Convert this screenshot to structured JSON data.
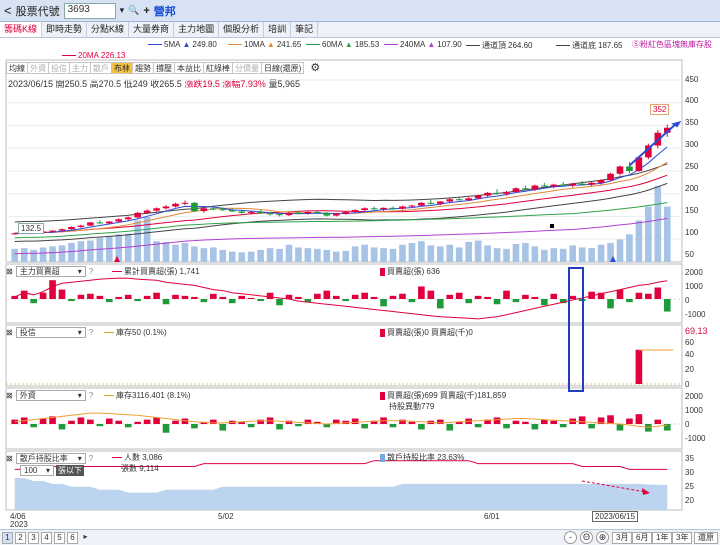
{
  "topbar": {
    "back_glyph": "<",
    "label": "股票代號",
    "code": "3693",
    "dropdown_glyph": "▾",
    "search_glyph": "🔍",
    "plus_glyph": "+",
    "name": "營邦"
  },
  "tabs": [
    {
      "label": "籌碼K線",
      "active": true
    },
    {
      "label": "即時走勢",
      "active": false
    },
    {
      "label": "分點K線",
      "active": false
    },
    {
      "label": "大量券商",
      "active": false
    },
    {
      "label": "主力地圖",
      "active": false
    },
    {
      "label": "個股分析",
      "active": false
    },
    {
      "label": "培訓",
      "active": false
    },
    {
      "label": "筆記",
      "active": false
    }
  ],
  "ma": [
    {
      "label": "20MA",
      "value": "226.13",
      "color": "#e1003c"
    },
    {
      "label": "5MA",
      "value": "249.80",
      "color": "#2a4bd7"
    },
    {
      "label": "10MA",
      "value": "241.65",
      "color": "#e08a3a"
    },
    {
      "label": "60MA",
      "value": "185.53",
      "color": "#2fa44a"
    },
    {
      "label": "240MA",
      "value": "107.90",
      "color": "#b13fd1"
    },
    {
      "label": "通道頂",
      "value": "264.60",
      "color": "#444444"
    },
    {
      "label": "通道底",
      "value": "187.65",
      "color": "#444444"
    }
  ],
  "ma_arrow": "▲",
  "hint": "Ⓢ粉紅色區塊無庫存股",
  "ind_tabs": [
    {
      "label": "均線",
      "dim": false,
      "active": false
    },
    {
      "label": "外資",
      "dim": true,
      "active": false
    },
    {
      "label": "投信",
      "dim": true,
      "active": false
    },
    {
      "label": "主力",
      "dim": true,
      "active": false
    },
    {
      "label": "散戶",
      "dim": true,
      "active": false
    },
    {
      "label": "布林",
      "dim": false,
      "active": true
    },
    {
      "label": "趨勢",
      "dim": false,
      "active": false
    },
    {
      "label": "撐壓",
      "dim": false,
      "active": false
    },
    {
      "label": "本益比",
      "dim": false,
      "active": false
    },
    {
      "label": "紅綠棒",
      "dim": false,
      "active": false
    },
    {
      "label": "分價量",
      "dim": true,
      "active": false
    },
    {
      "label": "日線(還原)",
      "dim": false,
      "active": false
    }
  ],
  "settings_glyph": "⚙",
  "quote": {
    "date": "2023/06/15",
    "open_label": "開",
    "open": "250.5",
    "high_label": "高",
    "high": "270.5",
    "low_label": "低",
    "low": "249",
    "close_label": "收",
    "close": "265.5",
    "chg_label": "漲跌",
    "chg": "19.5",
    "pct_label": "漲幅",
    "pct": "7.93%",
    "vol_label": "量",
    "vol": "5,965"
  },
  "price_y_labels": [
    "450",
    "400",
    "350",
    "300",
    "250",
    "200",
    "150",
    "100",
    "50"
  ],
  "price_badge_high": "352",
  "price_badge_low": "132.5",
  "pane1": {
    "select": "主力買賣超",
    "help": "?",
    "legend1": "累計買賣超(張) 1,741",
    "legend2": "買賣超(張) 636",
    "y_labels": [
      "2000",
      "1000",
      "0",
      "-1000",
      "-2000"
    ]
  },
  "pane2": {
    "select": "投信",
    "help": "?",
    "legend1": "庫存50 (0.1%)",
    "legend2": "買賣超(張)0 買賣超(千)0",
    "right_value": "69.13",
    "y_labels": [
      "60",
      "40",
      "20",
      "0"
    ]
  },
  "pane3": {
    "select": "外資",
    "help": "?",
    "legend1": "庫存3116.401 (8.1%)",
    "legend2": "買賣超(張)699 買賣超(千)181,859",
    "legend3": "持股異動779",
    "y_labels": [
      "2000",
      "1000",
      "0",
      "-1000",
      "-2000"
    ]
  },
  "pane4": {
    "select": "散戶持股比率",
    "help": "?",
    "sub_select": "100",
    "sub_label": "張以下",
    "legend1": "人數 3,086",
    "legend1b": "張數 9,114",
    "legend2": "散戶持股比率 23.63%",
    "y_labels": [
      "35",
      "30",
      "25",
      "20"
    ]
  },
  "x_labels": [
    {
      "text": "4/06",
      "sub": "2023"
    },
    {
      "text": "5/02",
      "sub": ""
    },
    {
      "text": "6/01",
      "sub": ""
    }
  ],
  "x_cursor_date": "2023/06/15",
  "pages": [
    "1",
    "2",
    "3",
    "4",
    "5",
    "6"
  ],
  "page_next": "▸",
  "zoom": [
    "-",
    "Θ",
    "⊕"
  ],
  "periods": [
    "3月",
    "6月",
    "1年",
    "3年",
    "還原"
  ],
  "colors": {
    "up": "#e1003c",
    "down": "#1f9a3a",
    "vol": "#a7c3e6"
  },
  "chart_data": {
    "type": "candlestick",
    "candles": [
      [
        112,
        114,
        110,
        113
      ],
      [
        113,
        116,
        112,
        115
      ],
      [
        115,
        118,
        113,
        114
      ],
      [
        114,
        118,
        113,
        117
      ],
      [
        117,
        120,
        115,
        119
      ],
      [
        119,
        124,
        118,
        122
      ],
      [
        122,
        128,
        121,
        127
      ],
      [
        127,
        132,
        125,
        130
      ],
      [
        130,
        138,
        129,
        137
      ],
      [
        137,
        142,
        134,
        135
      ],
      [
        135,
        140,
        133,
        139
      ],
      [
        139,
        146,
        137,
        144
      ],
      [
        144,
        150,
        142,
        148
      ],
      [
        148,
        160,
        146,
        158
      ],
      [
        158,
        166,
        155,
        163
      ],
      [
        163,
        170,
        160,
        168
      ],
      [
        168,
        175,
        165,
        172
      ],
      [
        172,
        180,
        170,
        178
      ],
      [
        178,
        185,
        175,
        180
      ],
      [
        180,
        182,
        160,
        162
      ],
      [
        162,
        170,
        158,
        168
      ],
      [
        168,
        172,
        164,
        166
      ],
      [
        166,
        170,
        162,
        164
      ],
      [
        164,
        168,
        160,
        161
      ],
      [
        161,
        165,
        156,
        158
      ],
      [
        158,
        162,
        154,
        160
      ],
      [
        160,
        164,
        156,
        157
      ],
      [
        157,
        160,
        152,
        155
      ],
      [
        155,
        158,
        150,
        153
      ],
      [
        153,
        160,
        151,
        158
      ],
      [
        158,
        162,
        155,
        157
      ],
      [
        157,
        161,
        154,
        160
      ],
      [
        160,
        164,
        156,
        158
      ],
      [
        158,
        160,
        150,
        152
      ],
      [
        152,
        158,
        150,
        156
      ],
      [
        156,
        162,
        154,
        160
      ],
      [
        160,
        166,
        158,
        164
      ],
      [
        164,
        170,
        162,
        168
      ],
      [
        168,
        172,
        164,
        166
      ],
      [
        166,
        170,
        162,
        169
      ],
      [
        169,
        172,
        165,
        167
      ],
      [
        167,
        174,
        165,
        172
      ],
      [
        172,
        176,
        170,
        174
      ],
      [
        174,
        182,
        172,
        180
      ],
      [
        180,
        186,
        176,
        178
      ],
      [
        178,
        184,
        175,
        183
      ],
      [
        183,
        190,
        180,
        188
      ],
      [
        188,
        194,
        185,
        186
      ],
      [
        186,
        192,
        184,
        190
      ],
      [
        190,
        198,
        188,
        196
      ],
      [
        196,
        204,
        193,
        202
      ],
      [
        202,
        210,
        198,
        200
      ],
      [
        200,
        206,
        196,
        204
      ],
      [
        204,
        214,
        202,
        212
      ],
      [
        212,
        218,
        208,
        210
      ],
      [
        210,
        220,
        206,
        218
      ],
      [
        218,
        224,
        214,
        216
      ],
      [
        216,
        222,
        212,
        220
      ],
      [
        220,
        226,
        216,
        218
      ],
      [
        218,
        224,
        214,
        222
      ],
      [
        222,
        228,
        218,
        220
      ],
      [
        220,
        226,
        216,
        224
      ],
      [
        224,
        232,
        220,
        230
      ],
      [
        230,
        246,
        228,
        244
      ],
      [
        244,
        262,
        240,
        260
      ],
      [
        260,
        270,
        245,
        250
      ],
      [
        250,
        282,
        248,
        280
      ],
      [
        280,
        310,
        276,
        306
      ],
      [
        306,
        340,
        300,
        334
      ],
      [
        334,
        352,
        325,
        345
      ]
    ],
    "volume": [
      38,
      40,
      35,
      42,
      45,
      48,
      55,
      60,
      62,
      70,
      75,
      80,
      82,
      120,
      130,
      60,
      58,
      50,
      55,
      45,
      40,
      42,
      35,
      30,
      28,
      30,
      35,
      40,
      38,
      50,
      42,
      40,
      38,
      35,
      30,
      32,
      45,
      50,
      42,
      40,
      38,
      50,
      55,
      60,
      48,
      45,
      50,
      42,
      58,
      62,
      48,
      40,
      38,
      52,
      55,
      45,
      35,
      40,
      38,
      48,
      42,
      40,
      50,
      55,
      65,
      80,
      120,
      160,
      220,
      160
    ],
    "ylim": [
      50,
      450
    ],
    "pane1_values": [
      300,
      800,
      -400,
      600,
      1800,
      900,
      -200,
      400,
      500,
      300,
      -300,
      200,
      400,
      -200,
      300,
      600,
      -500,
      400,
      300,
      200,
      -300,
      500,
      200,
      -400,
      300,
      100,
      -200,
      600,
      -600,
      400,
      200,
      -300,
      500,
      800,
      300,
      -200,
      400,
      600,
      200,
      -700,
      300,
      500,
      -300,
      1200,
      800,
      -900,
      400,
      600,
      -400,
      300,
      200,
      -500,
      800,
      -300,
      400,
      200,
      -600,
      500,
      -400,
      300,
      -200,
      700,
      600,
      -900,
      900,
      -300,
      600,
      500,
      1100,
      -1200
    ],
    "pane1_line": [
      200,
      600,
      400,
      700,
      1200,
      1500,
      1600,
      1700,
      1800,
      1900,
      1950,
      2000,
      1980,
      1900,
      1850,
      1800,
      1600,
      1500,
      1400,
      1300,
      1100,
      900,
      800,
      600,
      500,
      400,
      300,
      200,
      100,
      0,
      -200,
      -300,
      -400,
      -500,
      -600,
      -700,
      -800,
      -900,
      -1000,
      -1100,
      -1200,
      -1300,
      -1400,
      -1500,
      -1600,
      -1700,
      -1750,
      -1800,
      -1850,
      -1900,
      -1800,
      -1700,
      -1500,
      -1300,
      -1100,
      -900,
      -700,
      -500,
      -300,
      -100,
      100,
      300,
      500,
      700,
      900,
      1100,
      1300,
      1400,
      1600,
      1741
    ],
    "pane2_values": [
      0,
      0,
      0,
      0,
      0,
      0,
      0,
      0,
      0,
      0,
      0,
      0,
      0,
      0,
      0,
      0,
      0,
      0,
      0,
      0,
      0,
      0,
      0,
      0,
      0,
      0,
      0,
      0,
      0,
      0,
      0,
      0,
      0,
      0,
      0,
      0,
      0,
      0,
      0,
      0,
      0,
      0,
      0,
      0,
      0,
      0,
      0,
      0,
      0,
      0,
      0,
      0,
      0,
      0,
      0,
      0,
      0,
      0,
      0,
      0,
      0,
      0,
      0,
      0,
      0,
      0,
      50,
      0,
      0,
      0
    ],
    "pane3_values": [
      400,
      600,
      -300,
      500,
      700,
      -500,
      300,
      600,
      400,
      -200,
      500,
      300,
      -300,
      200,
      400,
      600,
      -800,
      300,
      500,
      -400,
      200,
      400,
      -600,
      300,
      200,
      -300,
      400,
      600,
      -500,
      300,
      -200,
      400,
      200,
      -300,
      400,
      300,
      500,
      -400,
      300,
      600,
      -300,
      400,
      200,
      -500,
      300,
      400,
      -600,
      200,
      500,
      -300,
      400,
      600,
      -400,
      300,
      200,
      -500,
      400,
      300,
      -300,
      500,
      700,
      -400,
      600,
      800,
      -600,
      500,
      900,
      -700,
      400,
      -600
    ],
    "pane3_line": [
      200,
      300,
      400,
      500,
      600,
      700,
      800,
      900,
      1000,
      1000,
      950,
      900,
      850,
      800,
      700,
      600,
      500,
      400,
      300,
      200,
      150,
      100,
      100,
      150,
      200,
      250,
      300,
      300,
      250,
      200,
      150,
      100,
      50,
      0,
      50,
      100,
      150,
      200,
      250,
      300,
      300,
      300,
      250,
      200,
      150,
      100,
      150,
      200,
      250,
      300,
      350,
      400,
      450,
      500,
      500,
      450,
      400,
      350,
      300,
      250,
      200,
      150,
      100,
      50,
      0,
      -100,
      -200,
      -300,
      -200,
      -100
    ],
    "pane4_people": [
      29,
      29,
      29,
      29,
      30,
      30,
      30,
      30,
      30,
      30,
      30,
      30,
      30,
      30,
      30,
      30,
      30,
      30,
      30,
      30,
      31,
      31,
      31,
      31,
      31,
      31,
      31,
      31,
      31,
      31,
      31,
      31,
      31,
      31,
      31,
      31,
      31,
      31,
      32,
      32,
      32,
      32,
      32,
      32,
      32,
      32,
      32,
      32,
      32,
      31,
      31,
      31,
      31,
      31,
      31,
      31,
      31,
      31,
      31,
      31,
      30,
      30,
      30,
      30,
      30,
      29,
      29,
      29,
      29,
      29
    ],
    "pane4_ratio": [
      26,
      26,
      25,
      25,
      24,
      24,
      23,
      23,
      23,
      22,
      22,
      22,
      21,
      21,
      21,
      21,
      22,
      22,
      22,
      22,
      22,
      22,
      23,
      23,
      23,
      23,
      23,
      23,
      23,
      23,
      23,
      23,
      23,
      23,
      23,
      23,
      23,
      23,
      23,
      23,
      23,
      24,
      24,
      24,
      24,
      24,
      24,
      24,
      24,
      24,
      24,
      24,
      24,
      24,
      24,
      24,
      24,
      24,
      24,
      24,
      24,
      24,
      24,
      24,
      24,
      24,
      24,
      23.8,
      23.7,
      23.63
    ],
    "pane4_ylim": [
      15,
      35
    ]
  }
}
